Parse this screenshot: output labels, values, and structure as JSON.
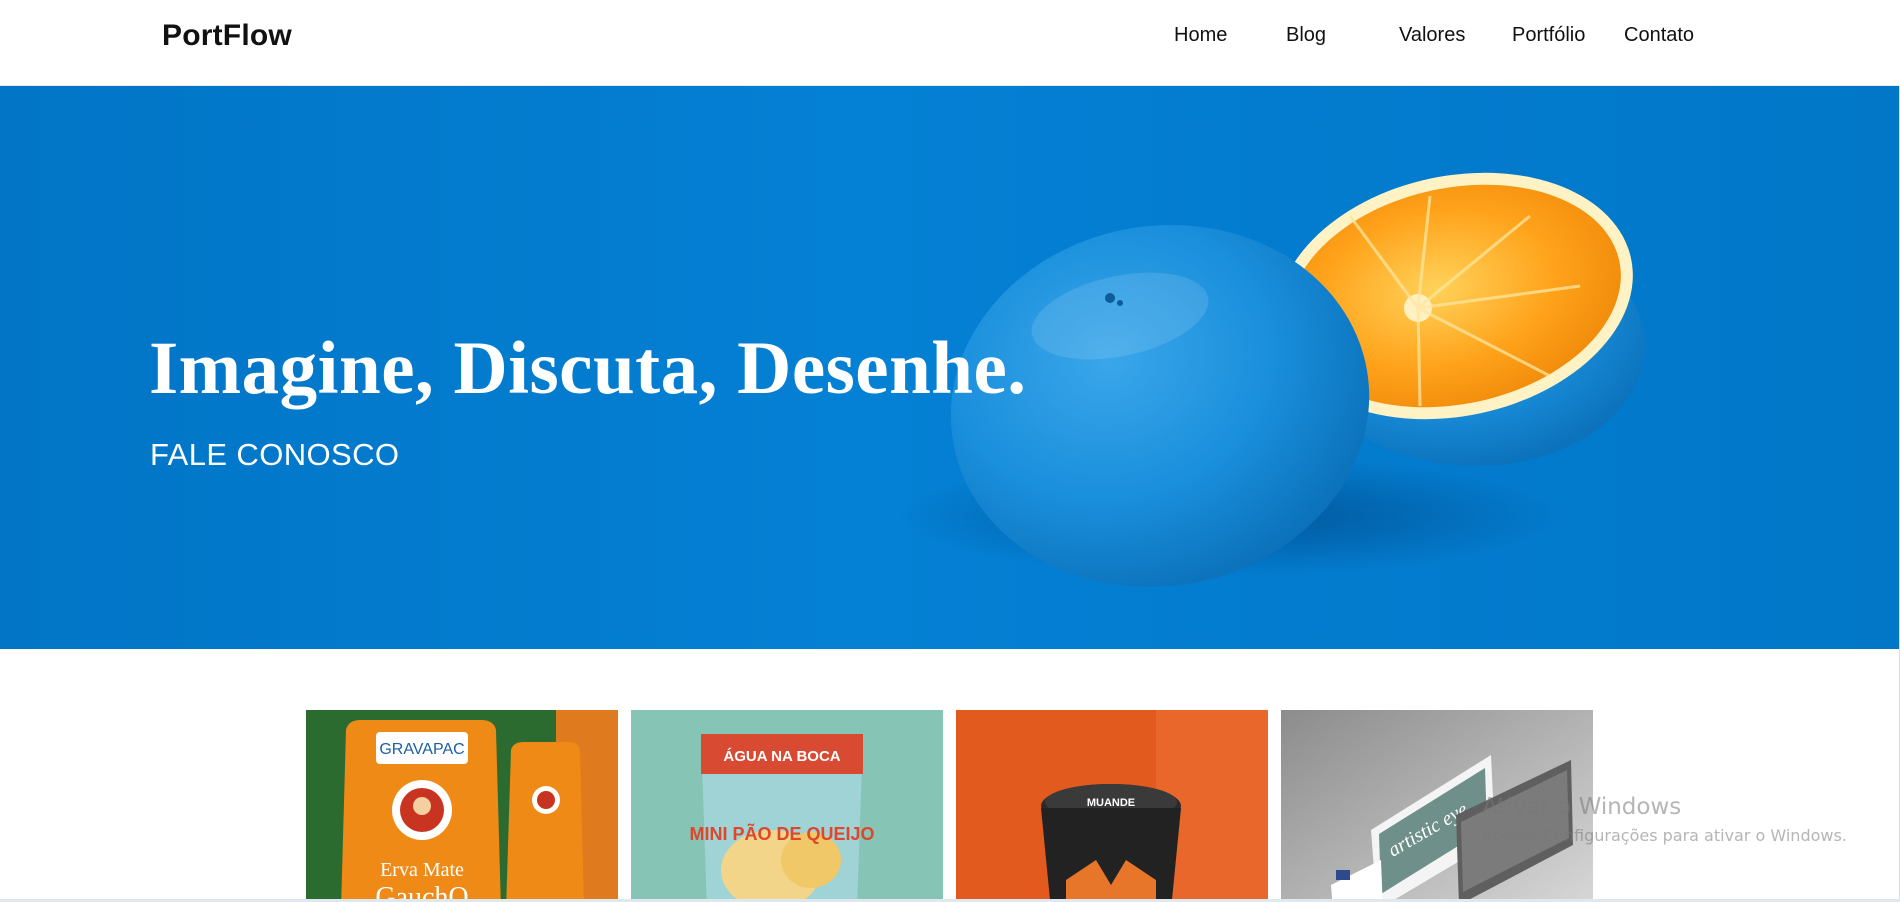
{
  "brand": {
    "name": "PortFlow"
  },
  "nav": {
    "items": [
      {
        "label": "Home"
      },
      {
        "label": "Blog"
      },
      {
        "label": "Valores"
      },
      {
        "label": "Portfólio"
      },
      {
        "label": "Contato"
      }
    ]
  },
  "hero": {
    "title": "Imagine, Discuta, Desenhe.",
    "cta": "FALE CONOSCO",
    "background_color": "#0480d4",
    "image": "blue-orange-photo"
  },
  "portfolio": {
    "cards": [
      {
        "image": "erva-mate-packaging",
        "brand": "GRAVAPAC",
        "product": "Erva Mate",
        "product_brand": "GauchO"
      },
      {
        "image": "chips-bag-packaging",
        "brand": "ÁGUA NA BOCA",
        "product": "MINI PÃO DE QUEIJO"
      },
      {
        "image": "ice-cream-tub-packaging",
        "brand": "MUANDE"
      },
      {
        "image": "website-mockup",
        "brand": "artistic eye"
      }
    ]
  },
  "watermark": {
    "title": "Ativar o Windows",
    "subtitle": "Acesse Configurações para ativar o Windows."
  }
}
